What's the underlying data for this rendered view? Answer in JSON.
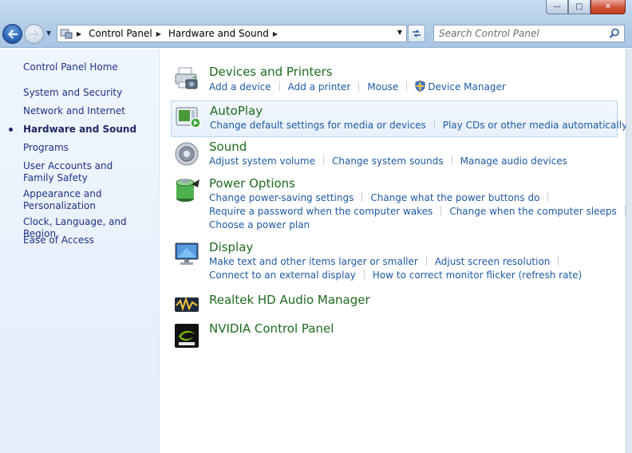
{
  "window": {
    "minimize_glyph": "—",
    "maximize_glyph": "□",
    "close_glyph": "✕"
  },
  "address": {
    "crumbs": [
      "Control Panel",
      "Hardware and Sound"
    ],
    "search_placeholder": "Search Control Panel"
  },
  "sidebar": {
    "home": "Control Panel Home",
    "items": [
      "System and Security",
      "Network and Internet",
      "Hardware and Sound",
      "Programs",
      "User Accounts and Family Safety",
      "Appearance and Personalization",
      "Clock, Language, and Region",
      "Ease of Access"
    ],
    "active_index": 2
  },
  "categories": {
    "devices": {
      "title": "Devices and Printers",
      "links": [
        "Add a device",
        "Add a printer",
        "Mouse",
        "Device Manager"
      ]
    },
    "autoplay": {
      "title": "AutoPlay",
      "links": [
        "Change default settings for media or devices",
        "Play CDs or other media automatically"
      ]
    },
    "sound": {
      "title": "Sound",
      "links": [
        "Adjust system volume",
        "Change system sounds",
        "Manage audio devices"
      ]
    },
    "power": {
      "title": "Power Options",
      "links": [
        "Change power-saving settings",
        "Change what the power buttons do",
        "Require a password when the computer wakes",
        "Change when the computer sleeps",
        "Choose a power plan"
      ]
    },
    "display": {
      "title": "Display",
      "links": [
        "Make text and other items larger or smaller",
        "Adjust screen resolution",
        "Connect to an external display",
        "How to correct monitor flicker (refresh rate)"
      ]
    },
    "realtek": {
      "title": "Realtek HD Audio Manager"
    },
    "nvidia": {
      "title": "NVIDIA Control Panel"
    }
  },
  "colors": {
    "link": "#1e5aa5",
    "category_title": "#1e6a1e",
    "sidebar_link": "#1e3287",
    "sidebar_bg": "#e8f1fb"
  }
}
